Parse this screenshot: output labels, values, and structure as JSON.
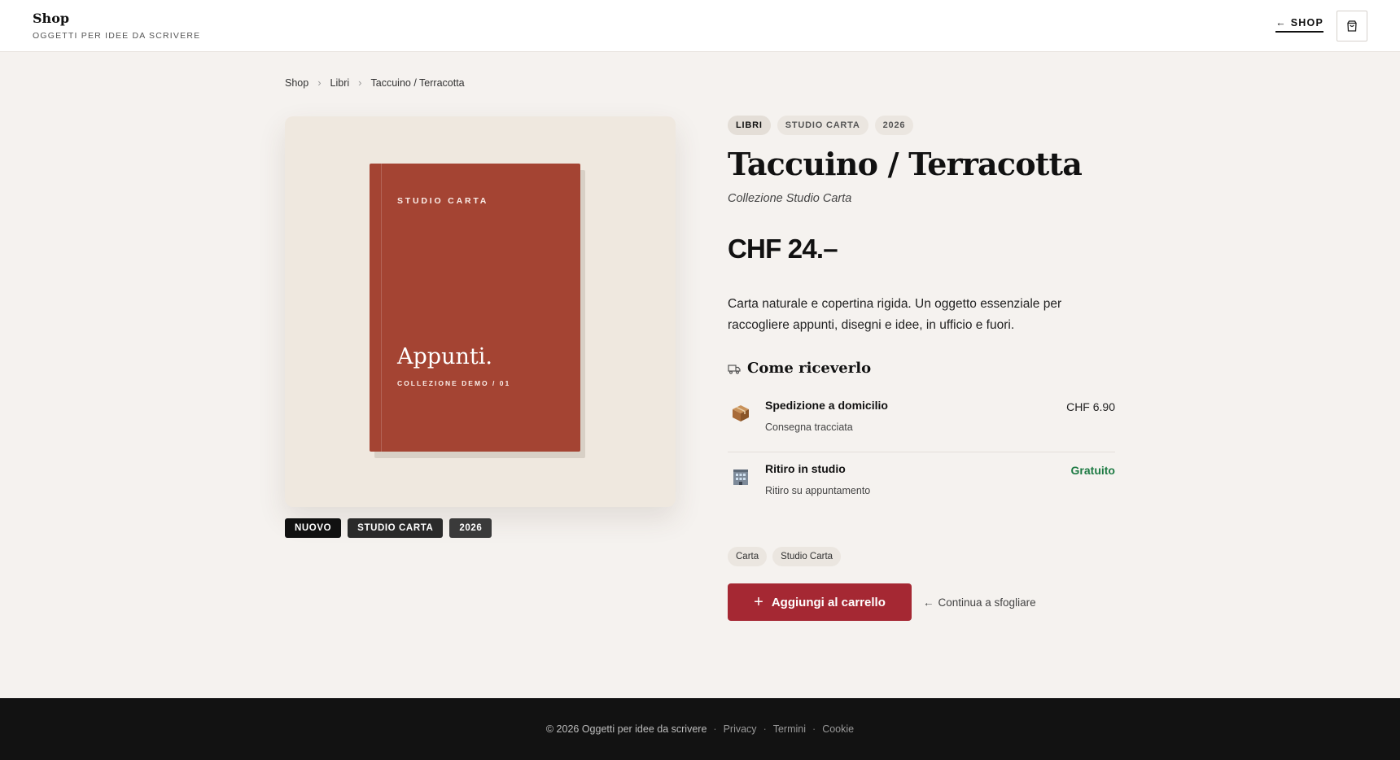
{
  "header": {
    "brand_name": "Shop",
    "tagline": "OGGETTI PER IDEE DA SCRIVERE",
    "shop_link": "SHOP"
  },
  "breadcrumb": [
    "Shop",
    "Libri",
    "Taccuino / Terracotta"
  ],
  "book_cover": {
    "brand": "STUDIO CARTA",
    "title": "Appunti.",
    "series": "COLLEZIONE DEMO / 01",
    "color": "#a44433"
  },
  "image_badges": [
    "NUOVO",
    "STUDIO CARTA",
    "2026"
  ],
  "product": {
    "tags": [
      "LIBRI",
      "STUDIO CARTA",
      "2026"
    ],
    "title": "Taccuino / Terracotta",
    "collection": "Collezione Studio Carta",
    "price": "CHF 24.–",
    "description": "Carta naturale e copertina rigida. Un oggetto essenziale per raccogliere appunti, disegni e idee, in ufficio e fuori."
  },
  "delivery": {
    "heading": "Come riceverlo",
    "options": [
      {
        "icon": "package-icon",
        "name": "Spedizione a domicilio",
        "detail": "Consegna tracciata",
        "price": "CHF 6.90"
      },
      {
        "icon": "building-icon",
        "name": "Ritiro in studio",
        "detail": "Ritiro su appuntamento",
        "price": "Gratuito"
      }
    ]
  },
  "keywords": [
    "Carta",
    "Studio Carta"
  ],
  "actions": {
    "add_to_cart": "Aggiungi al carrello",
    "continue": "Continua a sfogliare"
  },
  "footer": {
    "copyright": "© 2026 Oggetti per idee da scrivere",
    "links": [
      "Privacy",
      "Termini",
      "Cookie"
    ]
  },
  "colors": {
    "accent": "#a52833",
    "free": "#1d7a43",
    "background": "#f5f2ef"
  }
}
